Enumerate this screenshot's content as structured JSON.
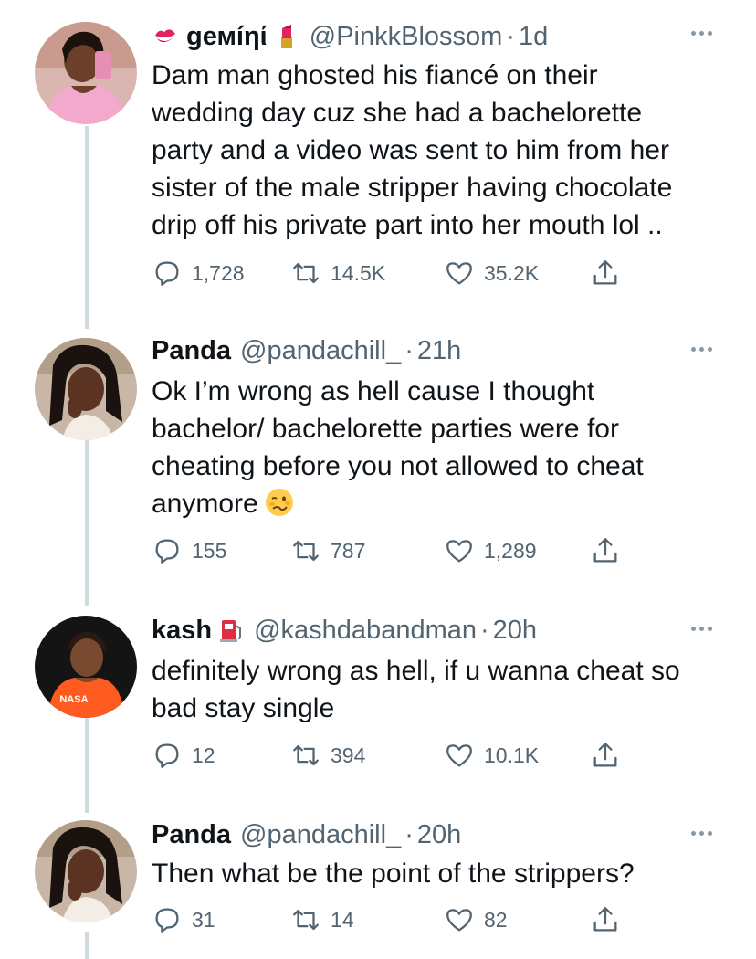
{
  "tweets": [
    {
      "name": "gемíηί",
      "name_prefix_icon": "kiss-mark-icon",
      "name_suffix_icon": "lipstick-icon",
      "handle": "@PinkkBlossom",
      "time": "1d",
      "lines": [
        "Dam man ghosted his fiancé on their",
        "wedding day cuz she had a bachelorette",
        "party and a video was sent to him from her",
        "sister of the male stripper having chocolate",
        "drip off his private part into her mouth lol .."
      ],
      "replies": "1,728",
      "retweets": "14.5K",
      "likes": "35.2K"
    },
    {
      "name": "Panda",
      "handle": "@pandachill_",
      "time": "21h",
      "lines": [
        "Ok I’m wrong as hell cause I thought",
        "bachelor/ bachelorette parties were for",
        "cheating before you not allowed to cheat",
        "anymore"
      ],
      "trailing_emoji": "woozy-face-icon",
      "replies": "155",
      "retweets": "787",
      "likes": "1,289"
    },
    {
      "name": "kash",
      "name_suffix_icon": "fuel-pump-icon",
      "handle": "@kashdabandman",
      "time": "20h",
      "lines": [
        "definitely wrong as hell, if u wanna cheat so",
        "bad stay single"
      ],
      "avatar_text": "NASA",
      "replies": "12",
      "retweets": "394",
      "likes": "10.1K"
    },
    {
      "name": "Panda",
      "handle": "@pandachill_",
      "time": "20h",
      "lines": [
        "Then what be the point of the strippers?"
      ],
      "replies": "31",
      "retweets": "14",
      "likes": "82"
    }
  ],
  "separator": "·",
  "colors": {
    "text": "#0f1419",
    "secondary": "#536471",
    "thread_line": "#cfd9de"
  }
}
